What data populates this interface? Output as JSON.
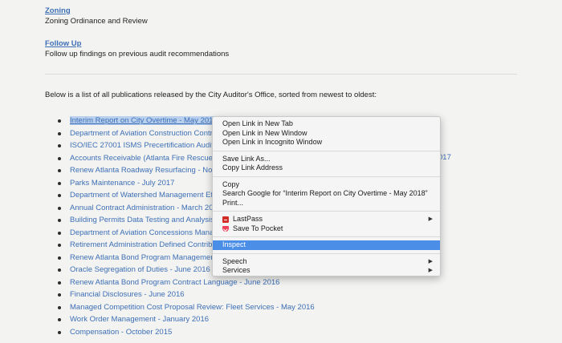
{
  "sections": [
    {
      "title": "Zoning",
      "description": "Zoning Ordinance and Review"
    },
    {
      "title": "Follow Up",
      "description": "Follow up findings on previous audit recommendations"
    }
  ],
  "intro": "Below is a list of all publications released by the City Auditor's Office, sorted from newest to oldest:",
  "publications": [
    "Interim Report on City Overtime - May 2018",
    "Department of Aviation Construction Contr",
    "ISO/IEC 27001 ISMS Precertification Audit",
    "Accounts Receivable (Atlanta Fire Rescue",
    "Renew Atlanta Roadway Resurfacing - No",
    "Parks Maintenance - July 2017",
    "Department of Watershed Management Ef",
    "Annual Contract Administration - March 20",
    "Building Permits Data Testing and Analysis",
    "Department of Aviation Concessions Mana",
    "Retirement Administration Defined Contrib",
    "Renew Atlanta Bond Program Managemer",
    "Oracle Segregation of Duties - June 2016",
    "Renew Atlanta Bond Program Contract Language - June 2016",
    "Financial Disclosures - June 2016",
    "Managed Competition Cost Proposal Review: Fleet Services - May 2016",
    "Work Order Management - January 2016",
    "Compensation - October 2015"
  ],
  "overflow_text": "017",
  "context_menu": {
    "groups": [
      [
        {
          "label": "Open Link in New Tab"
        },
        {
          "label": "Open Link in New Window"
        },
        {
          "label": "Open Link in Incognito Window"
        }
      ],
      [
        {
          "label": "Save Link As..."
        },
        {
          "label": "Copy Link Address"
        }
      ],
      [
        {
          "label": "Copy"
        },
        {
          "label": "Search Google for “Interim Report on City Overtime - May 2018”"
        },
        {
          "label": "Print..."
        }
      ],
      [
        {
          "label": "LastPass",
          "icon": "lastpass-icon",
          "submenu": true
        },
        {
          "label": "Save To Pocket",
          "icon": "pocket-icon"
        }
      ],
      [
        {
          "label": "Inspect",
          "highlighted": true
        }
      ],
      [
        {
          "label": "Speech",
          "submenu": true
        },
        {
          "label": "Services",
          "submenu": true
        }
      ]
    ],
    "submenu_arrow": "▶"
  },
  "colors": {
    "link": "#3d6fb6",
    "selection": "#b8d0ee",
    "menu_highlight": "#4b8ee8",
    "background": "#f3f3f1"
  }
}
